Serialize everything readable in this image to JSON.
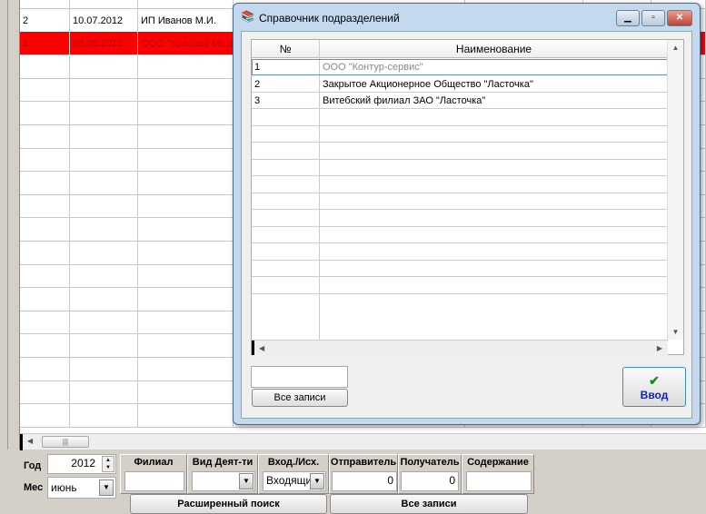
{
  "main_grid": {
    "rows": [
      {
        "no": "",
        "date": "",
        "org": ""
      },
      {
        "no": "2",
        "date": "10.07.2012",
        "org": "ИП Иванов М.И.",
        "highlight": false
      },
      {
        "no": "1",
        "date": "06.06.2012",
        "org": "ООО \"Красная Моск",
        "highlight": true
      }
    ],
    "highlight_color": "#ff0000"
  },
  "filters": {
    "year_label": "Год",
    "year_value": "2012",
    "month_label": "Мес",
    "month_value": "июнь",
    "branch_label": "Филиал",
    "branch_value": "",
    "activity_label": "Вид Деят-ти",
    "activity_value": "",
    "direction_label": "Вход./Исх.",
    "direction_value": "Входящи",
    "sender_label": "Отправитель",
    "sender_value": "0",
    "recipient_label": "Получатель",
    "recipient_value": "0",
    "content_label": "Содержание",
    "content_value": "",
    "advanced_search": "Расширенный поиск",
    "all_records": "Все записи"
  },
  "dialog": {
    "title": "Справочник подразделений",
    "columns": [
      "№",
      "Наименование"
    ],
    "rows": [
      {
        "no": "1",
        "name": "ООО \"Контур-сервис\""
      },
      {
        "no": "2",
        "name": "Закрытое Акционерное Общество \"Ласточка\""
      },
      {
        "no": "3",
        "name": "Витебский филиал ЗАО \"Ласточка\""
      }
    ],
    "search_value": "",
    "all_records": "Все записи",
    "enter": "Ввод"
  }
}
